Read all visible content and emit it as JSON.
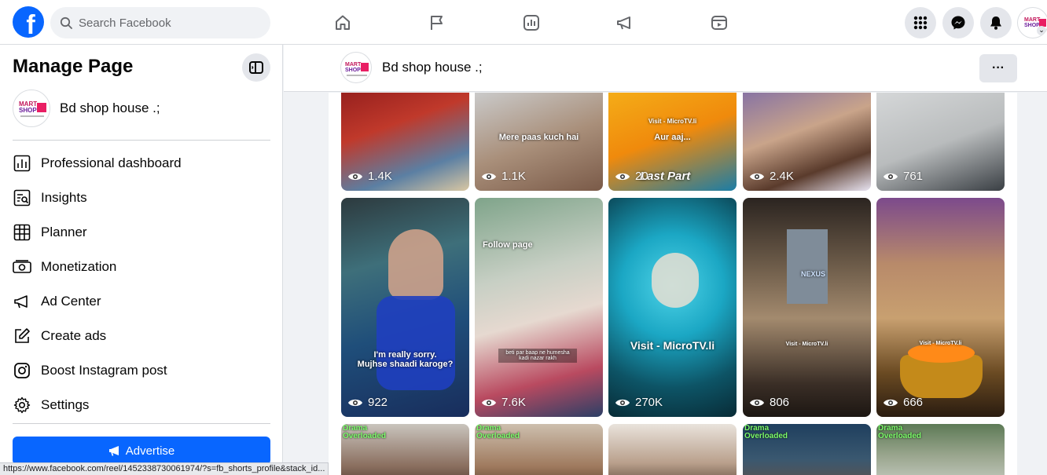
{
  "topbar": {
    "logo": "f",
    "search_placeholder": "Search Facebook",
    "nav_icons": [
      "home-icon",
      "flag-icon",
      "insights-icon",
      "megaphone-icon",
      "video-icon"
    ],
    "right_icons": [
      "apps-grid-icon",
      "messenger-icon",
      "bell-icon"
    ]
  },
  "sidebar": {
    "title": "Manage Page",
    "page_name": "Bd shop house .;",
    "items": [
      {
        "label": "Professional dashboard",
        "icon": "dashboard-icon"
      },
      {
        "label": "Insights",
        "icon": "insights-icon"
      },
      {
        "label": "Planner",
        "icon": "planner-icon"
      },
      {
        "label": "Monetization",
        "icon": "monetization-icon"
      },
      {
        "label": "Ad Center",
        "icon": "megaphone-icon"
      },
      {
        "label": "Create ads",
        "icon": "pencil-icon"
      },
      {
        "label": "Boost Instagram post",
        "icon": "instagram-icon"
      },
      {
        "label": "Settings",
        "icon": "gear-icon"
      }
    ],
    "advertise_label": "Advertise"
  },
  "page_header": {
    "name": "Bd shop house .;",
    "more_label": "···"
  },
  "logo_text": {
    "line1": "MART",
    "line2": "SHOP"
  },
  "reels": {
    "row1": [
      {
        "views": "1.4K",
        "caption": ""
      },
      {
        "views": "1.1K",
        "caption": "Mere paas kuch hai"
      },
      {
        "views": "20",
        "caption": "Aur aaj...",
        "overlay": "Last Part",
        "watermark": "Visit - MicroTV.li"
      },
      {
        "views": "2.4K",
        "caption": ""
      },
      {
        "views": "761",
        "caption": ""
      }
    ],
    "row2": [
      {
        "views": "922",
        "caption": "I'm really sorry.\nMujhse shaadi karoge?"
      },
      {
        "views": "7.6K",
        "caption": "beti par baap ne humesha kadi nazar rakh",
        "top_text": "Follow page"
      },
      {
        "views": "270K",
        "caption": "Visit - MicroTV.li"
      },
      {
        "views": "806",
        "caption": "Visit - MicroTV.li",
        "brand": "NEXUS"
      },
      {
        "views": "666",
        "caption": "Visit - MicroTV.li"
      }
    ],
    "row3": [
      {
        "tag": "Drama\nOverloaded"
      },
      {
        "tag": "Drama\nOverloaded"
      },
      {
        "tag": ""
      },
      {
        "tag": "Drama\nOverloaded"
      },
      {
        "tag": "Drama\nOverloaded"
      }
    ]
  },
  "status_url": "https://www.facebook.com/reel/1452338730061974/?s=fb_shorts_profile&stack_id..."
}
